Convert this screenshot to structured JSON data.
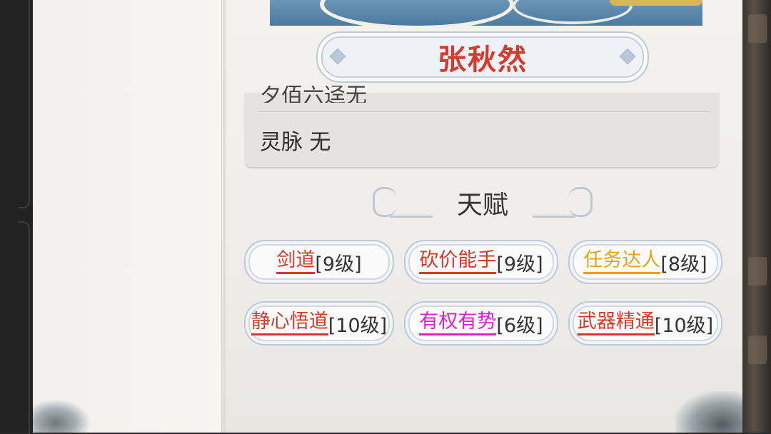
{
  "character": {
    "name": "张秋然",
    "info_rows": [
      {
        "label": "夕佰六迳无",
        "partial": true
      },
      {
        "label": "灵脉 无"
      }
    ]
  },
  "talents": {
    "title": "天赋",
    "items": [
      {
        "name": "剑道",
        "level": "[9级]",
        "color": "#d33a2a"
      },
      {
        "name": "砍价能手",
        "level": "[9级]",
        "color": "#d33a2a"
      },
      {
        "name": "任务达人",
        "level": "[8级]",
        "color": "#e2a41e"
      },
      {
        "name": "静心悟道",
        "level": "[10级]",
        "color": "#d33a2a"
      },
      {
        "name": "有权有势",
        "level": "[6级]",
        "color": "#d822d2"
      },
      {
        "name": "武器精通",
        "level": "[10级]",
        "color": "#d33a2a"
      }
    ]
  }
}
